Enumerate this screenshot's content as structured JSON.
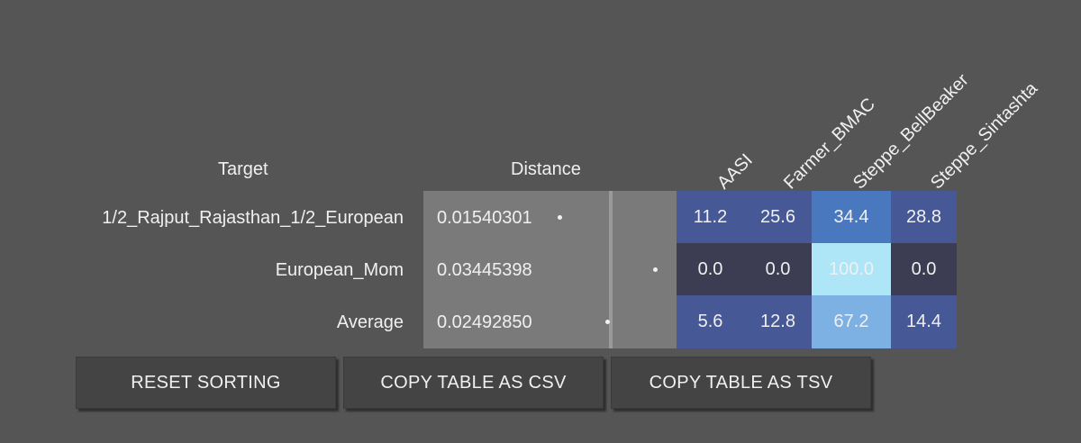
{
  "headers": {
    "target": "Target",
    "distance": "Distance",
    "columns": [
      "AASI",
      "Farmer_BMAC",
      "Steppe_BellBeaker",
      "Steppe_Sintashta"
    ]
  },
  "rows": [
    {
      "target": "1/2_Rajput_Rajasthan_1/2_European",
      "distance": "0.01540301",
      "values": [
        "11.2",
        "25.6",
        "34.4",
        "28.8"
      ],
      "colors": [
        "#475896",
        "#475896",
        "#4a78be",
        "#475896"
      ]
    },
    {
      "target": "European_Mom",
      "distance": "0.03445398",
      "values": [
        "0.0",
        "0.0",
        "100.0",
        "0.0"
      ],
      "colors": [
        "#3c3d52",
        "#3c3d52",
        "#aee5f7",
        "#3c3d52"
      ]
    },
    {
      "target": "Average",
      "distance": "0.02492850",
      "values": [
        "5.6",
        "12.8",
        "67.2",
        "14.4"
      ],
      "colors": [
        "#475896",
        "#475896",
        "#7db0e3",
        "#475896"
      ]
    }
  ],
  "buttons": {
    "reset": "RESET SORTING",
    "csv": "COPY TABLE AS CSV",
    "tsv": "COPY TABLE AS TSV"
  }
}
